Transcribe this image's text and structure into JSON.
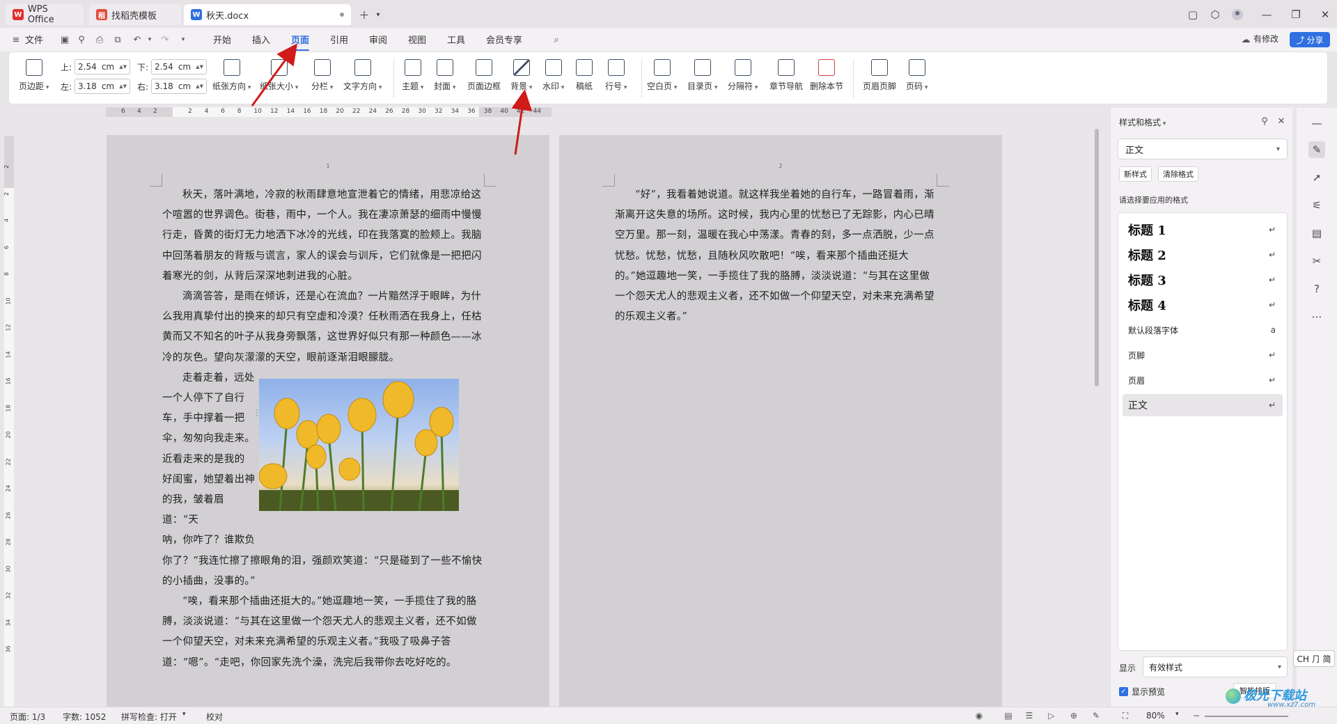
{
  "tabs": [
    {
      "label": "WPS Office",
      "logo": "W"
    },
    {
      "label": "找稻壳模板",
      "logo": "稻"
    },
    {
      "label": "秋天.docx",
      "logo": "W"
    }
  ],
  "menu": {
    "file": "文件",
    "items": [
      "开始",
      "插入",
      "页面",
      "引用",
      "审阅",
      "视图",
      "工具",
      "会员专享"
    ],
    "active": "页面",
    "revise_label": "有修改",
    "share_label": "分享"
  },
  "ribbon": {
    "margins_label": "页边距",
    "top_label": "上:",
    "top_value": "2.54",
    "top_unit": "cm",
    "bottom_label": "下:",
    "bottom_value": "2.54",
    "bottom_unit": "cm",
    "left_label": "左:",
    "left_value": "3.18",
    "left_unit": "cm",
    "right_label": "右:",
    "right_value": "3.18",
    "right_unit": "cm",
    "buttons_a": [
      "纸张方向",
      "纸张大小",
      "分栏",
      "文字方向"
    ],
    "buttons_b": [
      "主题",
      "封面",
      "页面边框",
      "背景",
      "水印",
      "稿纸",
      "行号"
    ],
    "buttons_c": [
      "空白页",
      "目录页",
      "分隔符",
      "章节导航",
      "删除本节"
    ],
    "buttons_d": [
      "页眉页脚",
      "页码"
    ]
  },
  "ruler": {
    "left_ticks": [
      "6",
      "4",
      "2"
    ],
    "ticks": [
      "2",
      "4",
      "6",
      "8",
      "10",
      "12",
      "14",
      "16",
      "18",
      "20",
      "22",
      "24",
      "26",
      "28",
      "30",
      "32",
      "34",
      "36",
      "38",
      "40",
      "42",
      "44"
    ],
    "vticks": [
      "2",
      "2",
      "4",
      "6",
      "8",
      "10",
      "12",
      "14",
      "16",
      "18",
      "20",
      "22",
      "24",
      "26",
      "28",
      "30",
      "32",
      "34",
      "36"
    ]
  },
  "page1": {
    "number": "1",
    "para1": "秋天，落叶满地，冷寂的秋雨肆意地宣泄着它的情绪，用悲凉给这个喧嚣的世界调色。街巷，雨中，一个人。我在凄凉萧瑟的细雨中慢慢行走，昏黄的街灯无力地洒下冰冷的光线，印在我落寞的脸颊上。我脑中回荡着朋友的背叛与谎言，家人的误会与训斥，它们就像是一把把闪着寒光的剑，从背后深深地刺进我的心脏。",
    "para2": "滴滴答答，是雨在倾诉，还是心在流血？一片黯然浮于眼眸，为什么我用真挚付出的换来的却只有空虚和冷漠？任秋雨洒在我身上，任枯黄而又不知名的叶子从我身旁飘落，这世界好似只有那一种颜色——冰冷的灰色。望向灰濛濛的天空，眼前逐渐泪眼朦胧。",
    "wrap_lines": [
      "走着走着，远处",
      "一个人停下了自行",
      "车，手中撑着一把",
      "伞，匆匆向我走来。",
      "近看走来的是我的",
      "好闺蜜，她望着出神",
      "的我，皱着眉道：“天",
      "呐，你咋了？谁欺负"
    ],
    "para3_rest": "你了？”我连忙擦了擦眼角的泪，强颜欢笑道：“只是碰到了一些不愉快的小插曲，没事的。”",
    "para4": "“唉，看来那个插曲还挺大的。”她逗趣地一笑，一手揽住了我的胳膊，淡淡说道：“与其在这里做一个怨天尤人的悲观主义者，还不如做一个仰望天空，对未来充满希望的乐观主义者。”我吸了吸鼻子答道：“嗯”。“走吧，你回家先洗个澡，洗完后我带你去吃好吃的。"
  },
  "page2": {
    "number": "2",
    "para1": "“好”，我看着她说道。就这样我坐着她的自行车，一路冒着雨，渐渐离开这失意的场所。这时候，我内心里的忧愁已了无踪影，内心已晴空万里。那一刻，温暖在我心中荡漾。青春的刻，多一点洒脱，少一点忧愁。忧愁，忧愁，且随秋风吹散吧！“唉，看来那个插曲还挺大的。”她逗趣地一笑，一手揽住了我的胳膊，淡淡说道：“与其在这里做一个怨天尤人的悲观主义者，还不如做一个仰望天空，对未来充满希望的乐观主义者。”"
  },
  "pane": {
    "title": "样式和格式",
    "current_style": "正文",
    "new_style": "新样式",
    "clear_format": "清除格式",
    "apply_label": "请选择要应用的格式",
    "styles": [
      {
        "name": "标题  1",
        "kind": "heading"
      },
      {
        "name": "标题  2",
        "kind": "heading"
      },
      {
        "name": "标题  3",
        "kind": "heading"
      },
      {
        "name": "标题  4",
        "kind": "heading"
      },
      {
        "name": "默认段落字体",
        "kind": "normal"
      },
      {
        "name": "页脚",
        "kind": "normal"
      },
      {
        "name": "页眉",
        "kind": "normal"
      },
      {
        "name": "正文",
        "kind": "normal"
      }
    ],
    "selected_style": "正文",
    "show_label": "显示",
    "show_value": "有效样式",
    "preview_label": "显示预览",
    "smart_label": "智能排版"
  },
  "ime": "CH ⺆ 简",
  "status": {
    "page": "页面: 1/3",
    "words": "字数: 1052",
    "spell": "拼写检查: 打开",
    "proof": "校对",
    "zoom": "80%"
  },
  "watermark": {
    "text": "极光下载站",
    "url": "www.xz7.com"
  },
  "colors": {
    "accent": "#2f6fe0",
    "annotation_arrow": "#d11a1a"
  }
}
